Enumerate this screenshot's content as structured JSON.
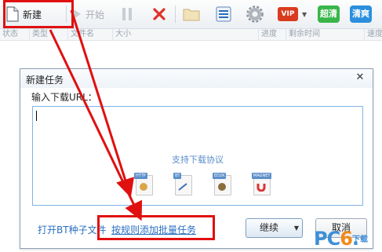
{
  "toolbar": {
    "new_label": "新建",
    "start_label": "开始",
    "vip_label": "VIP",
    "chaoqing_label": "超清",
    "qingshuang_label": "清爽",
    "icons": [
      "new-document-icon",
      "play-icon",
      "pause-icon",
      "delete-icon",
      "folder-icon",
      "list-icon",
      "settings-gear-icon",
      "vip-icon",
      "dropdown-icon"
    ],
    "colors": {
      "delete": "#e0322a",
      "vip": "#d93b1f",
      "green": "#39b54a",
      "blue": "#2b8fde",
      "annotation": "#e01010"
    }
  },
  "columns": [
    "状态",
    "类型",
    "文件名",
    "大小",
    "进度",
    "剩余时间",
    "速度"
  ],
  "dialog": {
    "title": "新建任务",
    "close_glyph": "✕",
    "url_label": "输入下载URL：",
    "url_value": "",
    "supported_title": "支持下载协议",
    "protocols": [
      "HTTP",
      "BT",
      "ED2K",
      "MAGNET"
    ],
    "bt_link": "打开BT种子文件",
    "batch_link": "按规则添加批量任务",
    "continue_button": "继续",
    "cancel_button": "取消"
  },
  "watermark": {
    "main_a": "PC",
    "main_b": "6",
    "main_c": ".",
    "sub": "下载"
  }
}
